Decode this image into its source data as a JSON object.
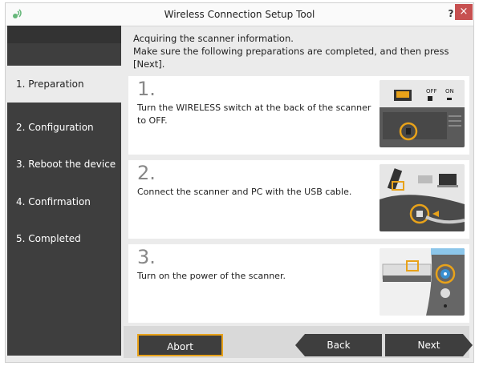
{
  "window": {
    "title": "Wireless Connection Setup Tool",
    "help_label": "?",
    "close_label": "×"
  },
  "sidebar": {
    "items": [
      {
        "label": "1. Preparation",
        "active": true
      },
      {
        "label": "2. Configuration",
        "active": false
      },
      {
        "label": "3. Reboot the device",
        "active": false
      },
      {
        "label": "4. Confirmation",
        "active": false
      },
      {
        "label": "5. Completed",
        "active": false
      }
    ]
  },
  "header": {
    "line1": "Acquiring the scanner information.",
    "line2": "Make sure the following preparations are completed, and then press [Next]."
  },
  "steps": [
    {
      "number": "1.",
      "text": "Turn the WIRELESS switch at the back of the scanner to OFF.",
      "switch_off": "OFF",
      "switch_on": "ON"
    },
    {
      "number": "2.",
      "text": "Connect the scanner and PC with the USB cable."
    },
    {
      "number": "3.",
      "text": "Turn on the power of the scanner."
    }
  ],
  "footer": {
    "abort_label": "Abort",
    "back_label": "Back",
    "next_label": "Next"
  },
  "colors": {
    "sidebar_bg": "#3e3e3e",
    "accent_orange": "#e8a21a",
    "close_red": "#c75050",
    "power_blue": "#3a8fd0"
  }
}
